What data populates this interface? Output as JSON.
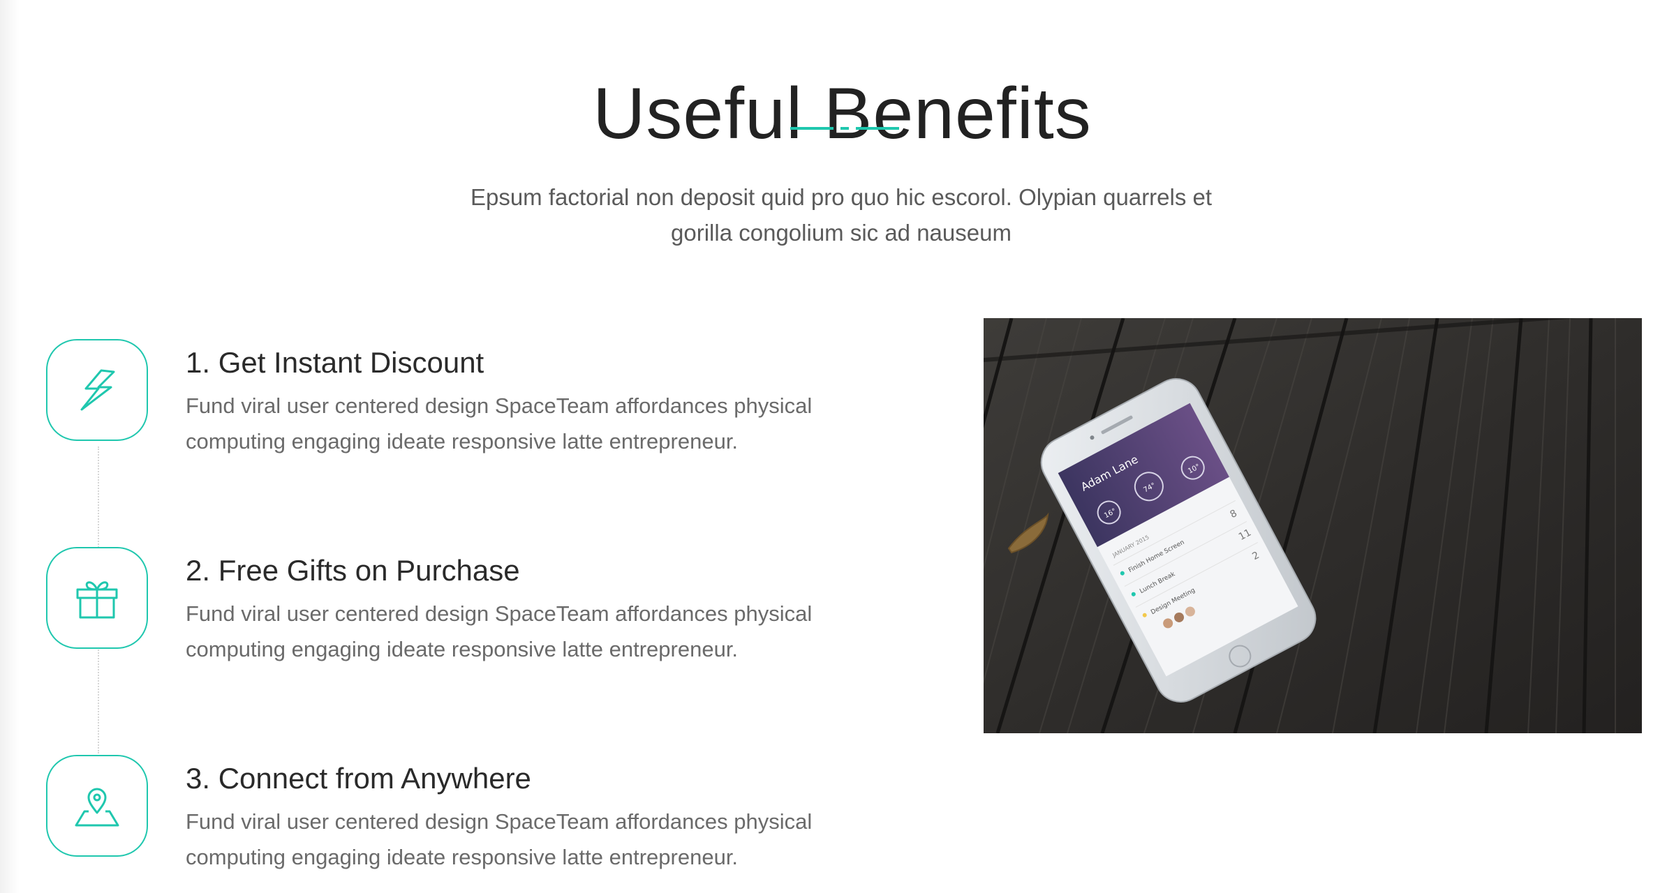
{
  "header": {
    "title": "Useful Benefits",
    "intro": "Epsum factorial non deposit quid pro quo hic escorol. Olypian quarrels et gorilla congolium sic ad nauseum"
  },
  "features": [
    {
      "title": "1. Get Instant Discount",
      "description": "Fund viral user centered design SpaceTeam affordances physical computing engaging ideate responsive latte entrepreneur.",
      "icon": "lightning-icon"
    },
    {
      "title": "2. Free Gifts on Purchase",
      "description": "Fund viral user centered design SpaceTeam affordances physical computing engaging ideate responsive latte entrepreneur.",
      "icon": "gift-icon"
    },
    {
      "title": "3. Connect from Anywhere",
      "description": "Fund viral user centered design SpaceTeam affordances physical computing engaging ideate responsive latte entrepreneur.",
      "icon": "map-pin-icon"
    }
  ],
  "phone_screen": {
    "name": "Adam Lane",
    "stats": [
      "16°",
      "74°",
      "10°"
    ],
    "list_header": "JANUARY 2015",
    "items": [
      {
        "label": "Finish Home Screen",
        "count": "8"
      },
      {
        "label": "Lunch Break",
        "count": "11"
      },
      {
        "label": "Design Meeting",
        "count": "2"
      }
    ]
  },
  "colors": {
    "accent": "#1fc7ae",
    "title": "#222222",
    "body_text": "#6a6a6a"
  }
}
